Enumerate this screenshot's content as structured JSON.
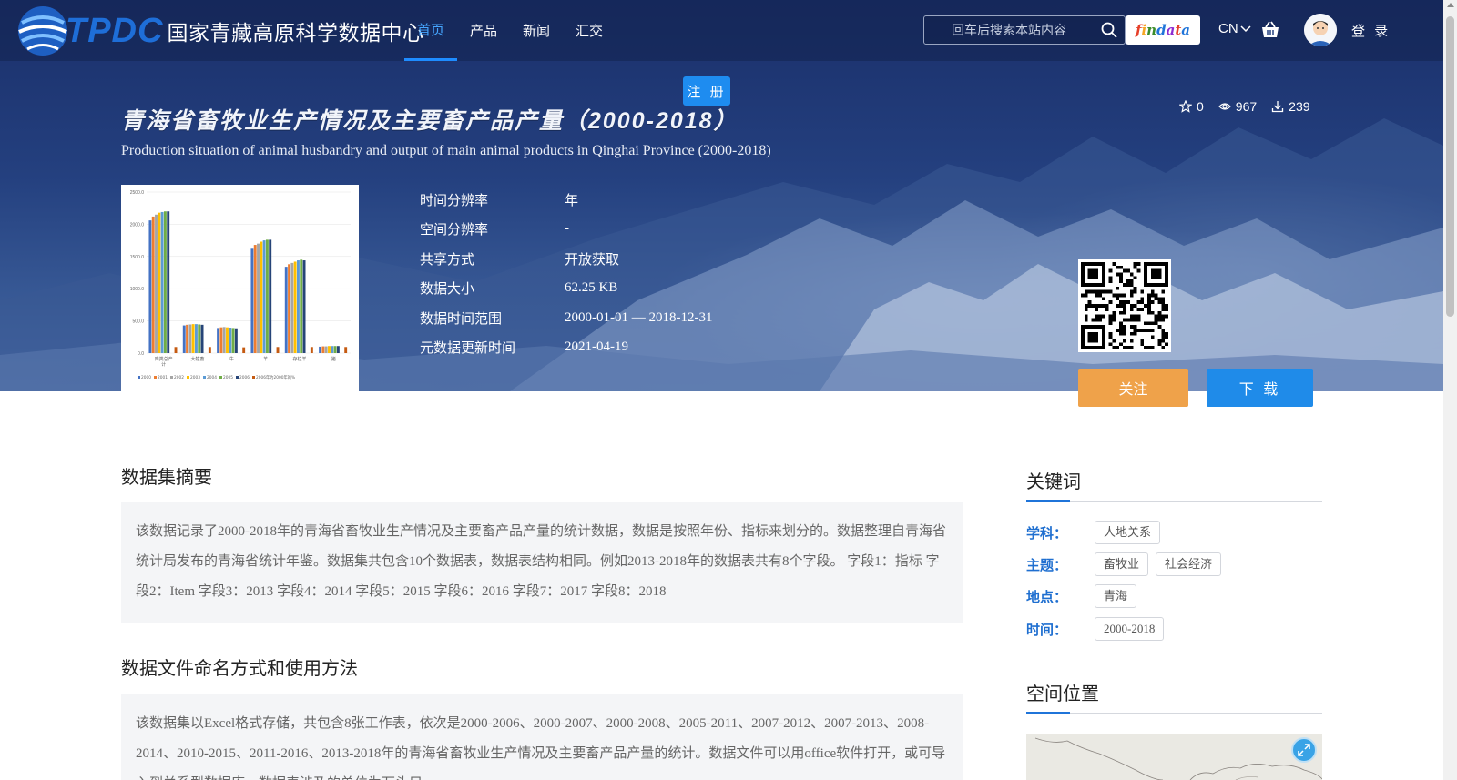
{
  "brand": {
    "short": "TPDC",
    "full": "国家青藏高原科学数据中心"
  },
  "nav": [
    {
      "label": "首页",
      "active": true
    },
    {
      "label": "产品"
    },
    {
      "label": "新闻"
    },
    {
      "label": "汇交"
    }
  ],
  "search": {
    "placeholder": "回车后搜索本站内容",
    "icon": "search-icon"
  },
  "findata": [
    "f",
    "i",
    "n",
    "d",
    "a",
    "t",
    "a"
  ],
  "lang": "CN",
  "login": "登 录",
  "register": "注 册",
  "dataset": {
    "title_cn": "青海省畜牧业生产情况及主要畜产品产量（2000-2018）",
    "title_en": "Production situation of animal husbandry and output of main animal products in Qinghai Province (2000-2018)",
    "stats": {
      "stars": "0",
      "views": "967",
      "downloads": "239"
    },
    "meta": [
      {
        "label": "时间分辨率",
        "value": "年"
      },
      {
        "label": "空间分辨率",
        "value": "-"
      },
      {
        "label": "共享方式",
        "value": "开放获取"
      },
      {
        "label": "数据大小",
        "value": "62.25 KB"
      },
      {
        "label": "数据时间范围",
        "value": "2000-01-01 — 2018-12-31"
      },
      {
        "label": "元数据更新时间",
        "value": "2021-04-19"
      }
    ],
    "follow_label": "关注",
    "download_label": "下 载"
  },
  "chart_data": {
    "type": "bar",
    "categories": [
      "肉类总产计",
      "大牲畜",
      "牛",
      "羊",
      "存栏羊",
      "猪"
    ],
    "category_labels": [
      "肉类总产\n计",
      "大牲畜",
      "牛",
      "羊",
      "存栏羊",
      "猪"
    ],
    "ylim": [
      0,
      2500
    ],
    "yticks": [
      "0.0",
      "500.0",
      "1000.0",
      "1500.0",
      "2000.0",
      "2500.0"
    ],
    "legend": [
      "2000",
      "2001",
      "2002",
      "2003",
      "2004",
      "2005",
      "2006",
      "2006年为2000年的%"
    ],
    "colors": [
      "#4472c4",
      "#ed7d31",
      "#a5a5a5",
      "#ffc000",
      "#5b9bd5",
      "#70ad47",
      "#264478",
      "#c55a11"
    ],
    "series": [
      {
        "name": "2000",
        "values": [
          2060,
          430,
          390,
          1620,
          1340,
          100
        ]
      },
      {
        "name": "2001",
        "values": [
          2120,
          440,
          400,
          1680,
          1380,
          105
        ]
      },
      {
        "name": "2002",
        "values": [
          2150,
          445,
          405,
          1700,
          1400,
          105
        ]
      },
      {
        "name": "2003",
        "values": [
          2180,
          450,
          400,
          1730,
          1420,
          110
        ]
      },
      {
        "name": "2004",
        "values": [
          2190,
          450,
          395,
          1750,
          1440,
          110
        ]
      },
      {
        "name": "2005",
        "values": [
          2200,
          445,
          390,
          1760,
          1450,
          110
        ]
      },
      {
        "name": "2006",
        "values": [
          2200,
          440,
          385,
          1760,
          1440,
          110
        ]
      },
      {
        "name": "2006年为2000年的%",
        "values": [
          95,
          95,
          90,
          95,
          95,
          95
        ]
      }
    ]
  },
  "abstract": {
    "heading": "数据集摘要",
    "text": "该数据记录了2000-2018年的青海省畜牧业生产情况及主要畜产品产量的统计数据，数据是按照年份、指标来划分的。数据整理自青海省统计局发布的青海省统计年鉴。数据集共包含10个数据表，数据表结构相同。例如2013-2018年的数据表共有8个字段。 字段1：指标 字段2：Item 字段3：2013 字段4：2014 字段5：2015 字段6：2016 字段7：2017 字段8：2018"
  },
  "naming": {
    "heading": "数据文件命名方式和使用方法",
    "text": "该数据集以Excel格式存储，共包含8张工作表，依次是2000-2006、2000-2007、2000-2008、2005-2011、2007-2012、2007-2013、2008-2014、2010-2015、2011-2016、2013-2018年的青海省畜牧业生产情况及主要畜产品产量的统计。数据文件可以用office软件打开，或可导入到关系型数据库。数据表涉及的单位为万头只。"
  },
  "keywords": {
    "heading": "关键词",
    "rows": [
      {
        "label": "学科：",
        "tags": [
          "人地关系"
        ]
      },
      {
        "label": "主题：",
        "tags": [
          "畜牧业",
          "社会经济"
        ]
      },
      {
        "label": "地点：",
        "tags": [
          "青海"
        ]
      },
      {
        "label": "时间：",
        "tags": [
          "2000-2018"
        ]
      }
    ]
  },
  "location": {
    "heading": "空间位置"
  },
  "colors": {
    "primary": "#1f8be9",
    "follow": "#efa24a",
    "nav_active": "#45a6ff",
    "keyword_label": "#1f6fd0"
  }
}
